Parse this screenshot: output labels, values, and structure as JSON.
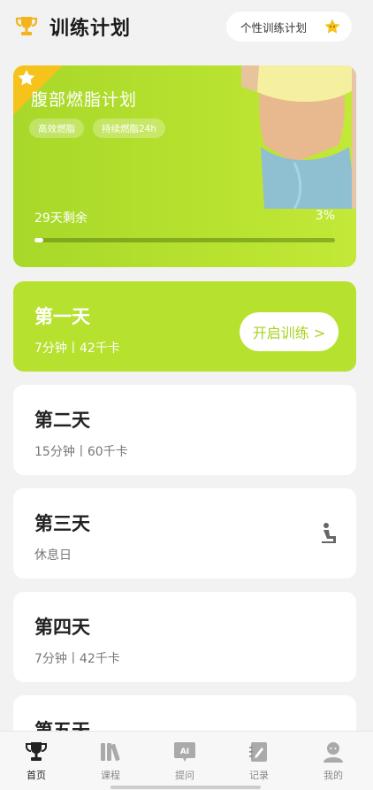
{
  "header": {
    "title": "训练计划",
    "custom_plan_label": "个性训练计划",
    "trophy_icon": "trophy-icon",
    "star_icon": "star-icon"
  },
  "plan": {
    "title": "腹部燃脂计划",
    "tags": [
      "高效燃脂",
      "持续燃脂24h"
    ],
    "remaining": "29天剩余",
    "percent_label": "3%",
    "progress": 0.03,
    "accent": "#b7e12f"
  },
  "days": [
    {
      "title": "第一天",
      "subtitle": "7分钟丨42千卡",
      "action": "开启训练 >"
    },
    {
      "title": "第二天",
      "subtitle": "15分钟丨60千卡"
    },
    {
      "title": "第三天",
      "subtitle": "休息日",
      "icon": "rest-chair-icon"
    },
    {
      "title": "第四天",
      "subtitle": "7分钟丨42千卡"
    },
    {
      "title": "第五天",
      "subtitle": ""
    }
  ],
  "tabs": [
    {
      "label": "首页",
      "icon": "trophy-icon"
    },
    {
      "label": "课程",
      "icon": "books-icon"
    },
    {
      "label": "提问",
      "icon": "ai-chat-icon",
      "icon_text": "AI"
    },
    {
      "label": "记录",
      "icon": "notebook-icon"
    },
    {
      "label": "我的",
      "icon": "user-icon"
    }
  ]
}
